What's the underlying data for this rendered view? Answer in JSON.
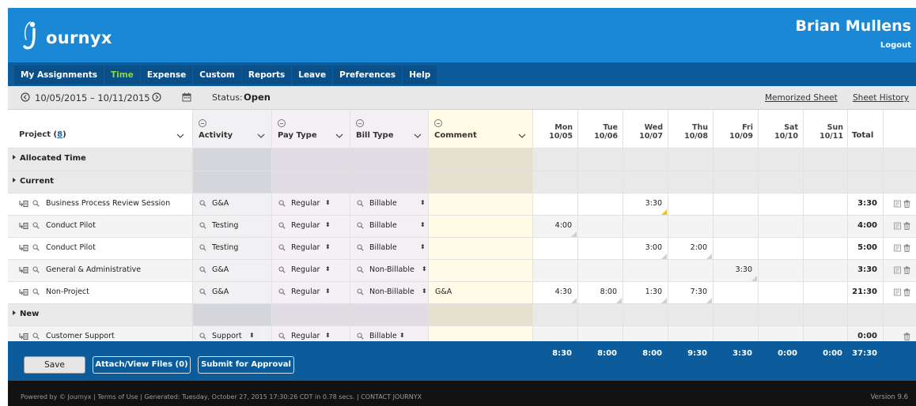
{
  "app": {
    "logo_text": "ournyx",
    "user_name": "Brian Mullens",
    "logout_label": "Logout"
  },
  "nav": [
    "My Assignments",
    "Time",
    "Expense",
    "Custom",
    "Reports",
    "Leave",
    "Preferences",
    "Help"
  ],
  "nav_active": "Time",
  "toolbar": {
    "date_range": "10/05/2015 – 10/11/2015",
    "status_label": "Status:",
    "status_value": "Open",
    "memorized_label": "Memorized Sheet",
    "history_label": "Sheet History"
  },
  "columns": {
    "project_label": "Project (",
    "project_count": "8",
    "project_suffix": ")",
    "activity": "Activity",
    "pay_type": "Pay Type",
    "bill_type": "Bill Type",
    "comment": "Comment",
    "days": [
      {
        "dow": "Mon",
        "date": "10/05"
      },
      {
        "dow": "Tue",
        "date": "10/06"
      },
      {
        "dow": "Wed",
        "date": "10/07"
      },
      {
        "dow": "Thu",
        "date": "10/08"
      },
      {
        "dow": "Fri",
        "date": "10/09"
      },
      {
        "dow": "Sat",
        "date": "10/10"
      },
      {
        "dow": "Sun",
        "date": "10/11"
      }
    ],
    "total": "Total"
  },
  "groups": {
    "allocated": "Allocated Time",
    "current": "Current",
    "new": "New"
  },
  "rows": [
    {
      "project": "Business Process Review Session",
      "activity": "G&A",
      "pay": "Regular",
      "bill": "Billable",
      "comment": "",
      "hours": [
        "",
        "",
        "3:30",
        "",
        "",
        "",
        ""
      ],
      "total": "3:30"
    },
    {
      "project": "Conduct Pilot",
      "activity": "Testing",
      "pay": "Regular",
      "bill": "Billable",
      "comment": "",
      "hours": [
        "4:00",
        "",
        "",
        "",
        "",
        "",
        ""
      ],
      "total": "4:00"
    },
    {
      "project": "Conduct Pilot",
      "activity": "Testing",
      "pay": "Regular",
      "bill": "Billable",
      "comment": "",
      "hours": [
        "",
        "",
        "3:00",
        "2:00",
        "",
        "",
        ""
      ],
      "total": "5:00"
    },
    {
      "project": "General & Administrative",
      "activity": "G&A",
      "pay": "Regular",
      "bill": "Non-Billable",
      "comment": "",
      "hours": [
        "",
        "",
        "",
        "",
        "3:30",
        "",
        ""
      ],
      "total": "3:30"
    },
    {
      "project": "Non-Project",
      "activity": "G&A",
      "pay": "Regular",
      "bill": "Non-Billable",
      "comment": "G&A",
      "hours": [
        "4:30",
        "8:00",
        "1:30",
        "7:30",
        "",
        "",
        ""
      ],
      "total": "21:30"
    },
    {
      "project": "Customer Support",
      "activity": "Support",
      "pay": "Regular",
      "bill": "Billable",
      "comment": "",
      "hours": [
        "",
        "",
        "",
        "",
        "",
        "",
        ""
      ],
      "total": "0:00"
    }
  ],
  "day_totals": [
    "8:30",
    "8:00",
    "8:00",
    "9:30",
    "3:30",
    "0:00",
    "0:00"
  ],
  "grand_total": "37:30",
  "buttons": {
    "save": "Save",
    "attach": "Attach/View Files (0)",
    "submit": "Submit for Approval"
  },
  "footer": {
    "text": "Powered by © Journyx | Terms of Use | Generated: Tuesday, October 27, 2015 17:30:26 CDT in 0.78 secs. | CONTACT JOURNYX",
    "version": "Version 9.6"
  },
  "colors": {
    "header": "#1b88d6",
    "nav": "#0c5c9c",
    "nav_active": "#8bd64a",
    "comment_col": "#fffbe6"
  }
}
